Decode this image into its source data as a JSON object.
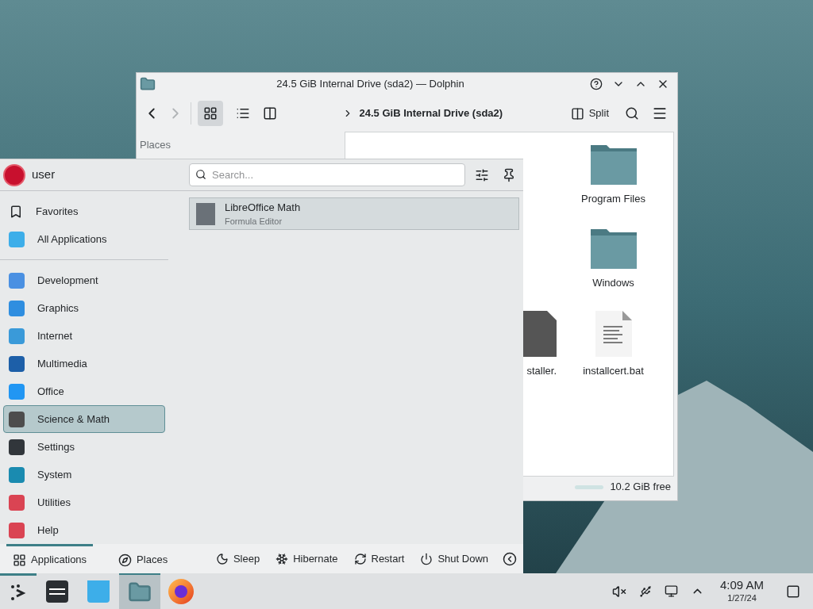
{
  "dolphin": {
    "title": "24.5 GiB Internal Drive (sda2) — Dolphin",
    "breadcrumb": "24.5 GiB Internal Drive (sda2)",
    "split_label": "Split",
    "places_heading": "Places",
    "files": [
      {
        "name": "Program Files",
        "kind": "folder"
      },
      {
        "name": "Windows",
        "kind": "folder"
      },
      {
        "name": "staller.",
        "kind": "exe"
      },
      {
        "name": "installcert.bat",
        "kind": "text"
      }
    ],
    "free_space": "10.2 GiB free"
  },
  "menu": {
    "user": "user",
    "search_placeholder": "Search...",
    "categories": [
      {
        "label": "Favorites",
        "selected": false
      },
      {
        "label": "All Applications",
        "color": "#3daee9",
        "selected": false
      },
      {
        "label": "Development",
        "color": "#4a90e2",
        "selected": false
      },
      {
        "label": "Graphics",
        "color": "#2f8ee0",
        "selected": false
      },
      {
        "label": "Internet",
        "color": "#3a9ad9",
        "selected": false
      },
      {
        "label": "Multimedia",
        "color": "#1d5fa8",
        "selected": false
      },
      {
        "label": "Office",
        "color": "#2196f3",
        "selected": false
      },
      {
        "label": "Science & Math",
        "color": "#4d4d4d",
        "selected": true
      },
      {
        "label": "Settings",
        "color": "#31363b",
        "selected": false
      },
      {
        "label": "System",
        "color": "#1a8bb0",
        "selected": false
      },
      {
        "label": "Utilities",
        "color": "#da4453",
        "selected": false
      },
      {
        "label": "Help",
        "color": "#da4453",
        "selected": false
      }
    ],
    "results": [
      {
        "name": "LibreOffice Math",
        "description": "Formula Editor"
      }
    ],
    "tabs": [
      {
        "label": "Applications",
        "selected": true
      },
      {
        "label": "Places",
        "selected": false
      }
    ],
    "power": [
      "Sleep",
      "Hibernate",
      "Restart",
      "Shut Down"
    ]
  },
  "taskbar": {
    "apps": [
      {
        "kind": "settings",
        "active": false
      },
      {
        "kind": "store",
        "active": false
      },
      {
        "kind": "files",
        "active": true
      },
      {
        "kind": "browser",
        "active": false
      }
    ],
    "time": "4:09 AM",
    "date": "1/27/24"
  }
}
